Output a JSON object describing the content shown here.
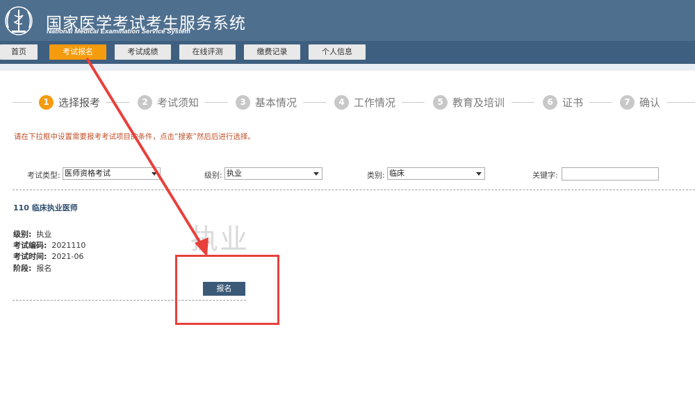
{
  "header": {
    "title_cn": "国家医学考试考生服务系统",
    "title_en": "National Medical Examination Service System"
  },
  "nav": {
    "tabs": [
      {
        "label": "首页"
      },
      {
        "label": "考试报名"
      },
      {
        "label": "考试成绩"
      },
      {
        "label": "在线评测"
      },
      {
        "label": "缴费记录"
      },
      {
        "label": "个人信息"
      }
    ],
    "active_index": 1
  },
  "steps": [
    {
      "num": "1",
      "label": "选择报考"
    },
    {
      "num": "2",
      "label": "考试须知"
    },
    {
      "num": "3",
      "label": "基本情况"
    },
    {
      "num": "4",
      "label": "工作情况"
    },
    {
      "num": "5",
      "label": "教育及培训"
    },
    {
      "num": "6",
      "label": "证书"
    },
    {
      "num": "7",
      "label": "确认"
    }
  ],
  "hint": "请在下拉框中设置需要报考考试项目的条件，点击“搜索”然后后进行选择。",
  "filters": {
    "exam_type_label": "考试类型:",
    "exam_type_value": "医师资格考试",
    "level_label": "级别:",
    "level_value": "执业",
    "category_label": "类别:",
    "category_value": "临床",
    "keyword_label": "关键字:",
    "keyword_value": ""
  },
  "exam": {
    "title": "110 临床执业医师",
    "level_label": "级别:",
    "level_value": "执业",
    "code_label": "考试编码:",
    "code_value": "2021110",
    "time_label": "考试时间:",
    "time_value": "2021-06",
    "stage_label": "阶段:",
    "stage_value": "报名",
    "watermark": "执业",
    "apply_button": "报名"
  },
  "annotation_color": "#e8403b",
  "accent_color": "#f49b0e"
}
